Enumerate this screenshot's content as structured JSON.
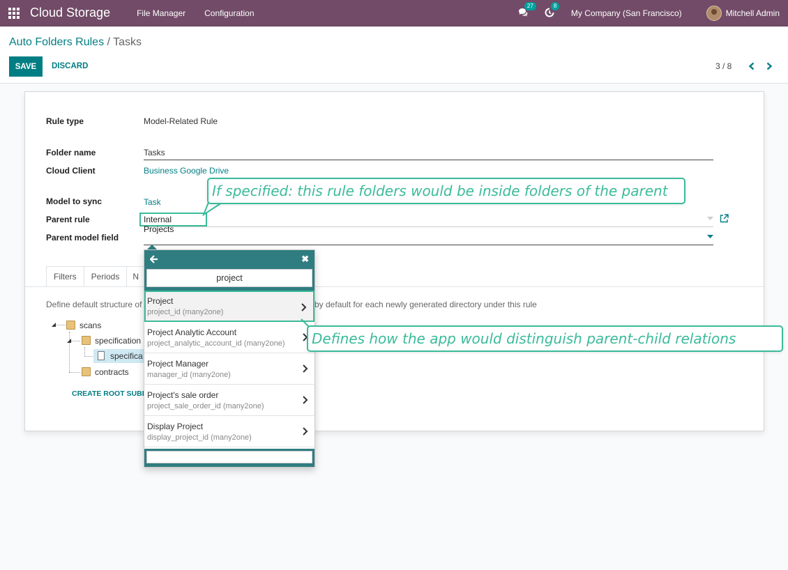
{
  "navbar": {
    "app_title": "Cloud Storage",
    "menu": [
      "File Manager",
      "Configuration"
    ],
    "messages_count": "27",
    "activities_count": "8",
    "company": "My Company (San Francisco)",
    "user": "Mitchell Admin",
    "brand_color": "#714b67"
  },
  "breadcrumb": {
    "parent": "Auto Folders Rules",
    "separator": "/",
    "current": "Tasks"
  },
  "actions": {
    "save": "SAVE",
    "discard": "DISCARD"
  },
  "pager": {
    "value": "3 / 8"
  },
  "form": {
    "rule_type_label": "Rule type",
    "rule_type_value": "Model-Related Rule",
    "folder_name_label": "Folder name",
    "folder_name_value": "Tasks",
    "cloud_client_label": "Cloud Client",
    "cloud_client_value": "Business Google Drive",
    "model_label": "Model to sync",
    "model_value": "Task",
    "parent_rule_label": "Parent rule",
    "parent_rule_value": "Internal Projects",
    "parent_field_label": "Parent model field"
  },
  "tabs": [
    "Filters",
    "Periods",
    "N"
  ],
  "structure": {
    "description_left": "Define default structure of",
    "description_right": "by default for each newly generated directory under this rule",
    "tree": [
      {
        "label": "scans",
        "kind": "folder"
      },
      {
        "label": "specification",
        "kind": "folder"
      },
      {
        "label": "specifica",
        "kind": "file"
      },
      {
        "label": "contracts",
        "kind": "folder"
      }
    ],
    "create_label": "CREATE ROOT SUBFO"
  },
  "popup": {
    "search_value": "project",
    "items": [
      {
        "title": "Project",
        "field": "project_id (many2one)"
      },
      {
        "title": "Project Analytic Account",
        "field": "project_analytic_account_id (many2one)"
      },
      {
        "title": "Project Manager",
        "field": "manager_id (many2one)"
      },
      {
        "title": "Project's sale order",
        "field": "project_sale_order_id (many2one)"
      },
      {
        "title": "Display Project",
        "field": "display_project_id (many2one)"
      }
    ]
  },
  "callouts": {
    "parent_rule": "If specified: this rule folders would be inside folders of the parent",
    "parent_field": "Defines how the app would distinguish parent-child relations",
    "accent_color": "#3bbb9a"
  }
}
